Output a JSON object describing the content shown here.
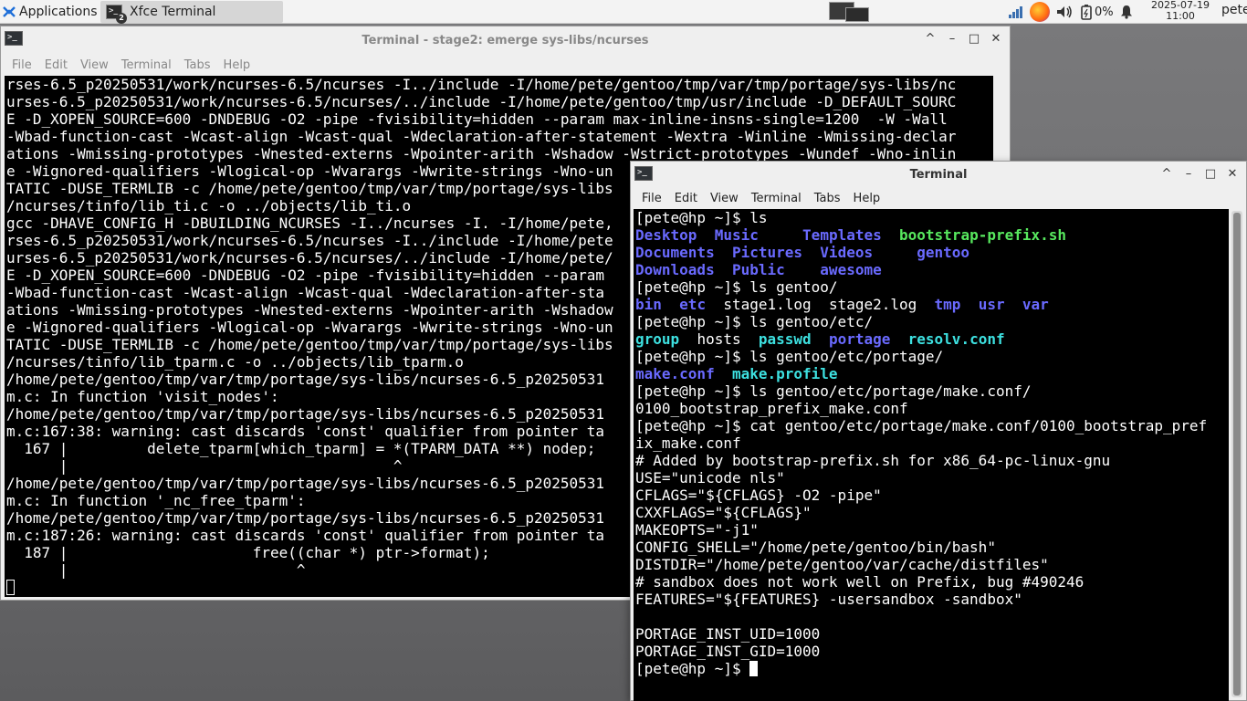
{
  "panel": {
    "apps_label": "Applications",
    "task_label": "Xfce Terminal",
    "task_badge": "2",
    "battery": "0%",
    "date": "2025-07-19",
    "time": "11:00",
    "user": "pete"
  },
  "win1": {
    "title": "Terminal - stage2: emerge sys-libs/ncurses",
    "menu": [
      "File",
      "Edit",
      "View",
      "Terminal",
      "Tabs",
      "Help"
    ],
    "lines": [
      "rses-6.5_p20250531/work/ncurses-6.5/ncurses -I../include -I/home/pete/gentoo/tmp/var/tmp/portage/sys-libs/nc",
      "urses-6.5_p20250531/work/ncurses-6.5/ncurses/../include -I/home/pete/gentoo/tmp/usr/include -D_DEFAULT_SOURC",
      "E -D_XOPEN_SOURCE=600 -DNDEBUG -O2 -pipe -fvisibility=hidden --param max-inline-insns-single=1200  -W -Wall",
      "-Wbad-function-cast -Wcast-align -Wcast-qual -Wdeclaration-after-statement -Wextra -Winline -Wmissing-declar",
      "ations -Wmissing-prototypes -Wnested-externs -Wpointer-arith -Wshadow -Wstrict-prototypes -Wundef -Wno-inlin",
      "e -Wignored-qualifiers -Wlogical-op -Wvarargs -Wwrite-strings -Wno-un",
      "TATIC -DUSE_TERMLIB -c /home/pete/gentoo/tmp/var/tmp/portage/sys-libs",
      "/ncurses/tinfo/lib_ti.c -o ../objects/lib_ti.o",
      "gcc -DHAVE_CONFIG_H -DBUILDING_NCURSES -I../ncurses -I. -I/home/pete,",
      "rses-6.5_p20250531/work/ncurses-6.5/ncurses -I../include -I/home/pete",
      "urses-6.5_p20250531/work/ncurses-6.5/ncurses/../include -I/home/pete/",
      "E -D_XOPEN_SOURCE=600 -DNDEBUG -O2 -pipe -fvisibility=hidden --param",
      "-Wbad-function-cast -Wcast-align -Wcast-qual -Wdeclaration-after-sta",
      "ations -Wmissing-prototypes -Wnested-externs -Wpointer-arith -Wshadow",
      "e -Wignored-qualifiers -Wlogical-op -Wvarargs -Wwrite-strings -Wno-un",
      "TATIC -DUSE_TERMLIB -c /home/pete/gentoo/tmp/var/tmp/portage/sys-libs",
      "/ncurses/tinfo/lib_tparm.c -o ../objects/lib_tparm.o",
      "/home/pete/gentoo/tmp/var/tmp/portage/sys-libs/ncurses-6.5_p20250531",
      "m.c: In function 'visit_nodes':",
      "/home/pete/gentoo/tmp/var/tmp/portage/sys-libs/ncurses-6.5_p20250531",
      "m.c:167:38: warning: cast discards 'const' qualifier from pointer ta",
      "  167 |         delete_tparm[which_tparm] = *(TPARM_DATA **) nodep;",
      "      |                                     ^",
      "/home/pete/gentoo/tmp/var/tmp/portage/sys-libs/ncurses-6.5_p20250531",
      "m.c: In function '_nc_free_tparm':",
      "/home/pete/gentoo/tmp/var/tmp/portage/sys-libs/ncurses-6.5_p20250531",
      "m.c:187:26: warning: cast discards 'const' qualifier from pointer ta",
      "  187 |                     free((char *) ptr->format);",
      "      |                          ^"
    ]
  },
  "win2": {
    "title": "Terminal",
    "menu": [
      "File",
      "Edit",
      "View",
      "Terminal",
      "Tabs",
      "Help"
    ],
    "lines": [
      [
        {
          "t": "[pete@hp ~]$ ls"
        }
      ],
      [
        {
          "t": "Desktop",
          "c": "blue"
        },
        {
          "t": "  "
        },
        {
          "t": "Music",
          "c": "blue"
        },
        {
          "t": "     "
        },
        {
          "t": "Templates",
          "c": "blue"
        },
        {
          "t": "  "
        },
        {
          "t": "bootstrap-prefix.sh",
          "c": "green"
        }
      ],
      [
        {
          "t": "Documents",
          "c": "blue"
        },
        {
          "t": "  "
        },
        {
          "t": "Pictures",
          "c": "blue"
        },
        {
          "t": "  "
        },
        {
          "t": "Videos",
          "c": "blue"
        },
        {
          "t": "     "
        },
        {
          "t": "gentoo",
          "c": "blue"
        }
      ],
      [
        {
          "t": "Downloads",
          "c": "blue"
        },
        {
          "t": "  "
        },
        {
          "t": "Public",
          "c": "blue"
        },
        {
          "t": "    "
        },
        {
          "t": "awesome",
          "c": "blue"
        }
      ],
      [
        {
          "t": "[pete@hp ~]$ ls gentoo/"
        }
      ],
      [
        {
          "t": "bin",
          "c": "blue"
        },
        {
          "t": "  "
        },
        {
          "t": "etc",
          "c": "blue"
        },
        {
          "t": "  stage1.log  stage2.log  "
        },
        {
          "t": "tmp",
          "c": "blue"
        },
        {
          "t": "  "
        },
        {
          "t": "usr",
          "c": "blue"
        },
        {
          "t": "  "
        },
        {
          "t": "var",
          "c": "blue"
        }
      ],
      [
        {
          "t": "[pete@hp ~]$ ls gentoo/etc/"
        }
      ],
      [
        {
          "t": "group",
          "c": "cyan"
        },
        {
          "t": "  hosts  "
        },
        {
          "t": "passwd",
          "c": "cyan"
        },
        {
          "t": "  "
        },
        {
          "t": "portage",
          "c": "blue"
        },
        {
          "t": "  "
        },
        {
          "t": "resolv.conf",
          "c": "cyan"
        }
      ],
      [
        {
          "t": "[pete@hp ~]$ ls gentoo/etc/portage/"
        }
      ],
      [
        {
          "t": "make.conf",
          "c": "blue"
        },
        {
          "t": "  "
        },
        {
          "t": "make.profile",
          "c": "cyan"
        }
      ],
      [
        {
          "t": "[pete@hp ~]$ ls gentoo/etc/portage/make.conf/"
        }
      ],
      [
        {
          "t": "0100_bootstrap_prefix_make.conf"
        }
      ],
      [
        {
          "t": "[pete@hp ~]$ cat gentoo/etc/portage/make.conf/0100_bootstrap_pref"
        }
      ],
      [
        {
          "t": "ix_make.conf"
        }
      ],
      [
        {
          "t": "# Added by bootstrap-prefix.sh for x86_64-pc-linux-gnu"
        }
      ],
      [
        {
          "t": "USE=\"unicode nls\""
        }
      ],
      [
        {
          "t": "CFLAGS=\"${CFLAGS} -O2 -pipe\""
        }
      ],
      [
        {
          "t": "CXXFLAGS=\"${CFLAGS}\""
        }
      ],
      [
        {
          "t": "MAKEOPTS=\"-j1\""
        }
      ],
      [
        {
          "t": "CONFIG_SHELL=\"/home/pete/gentoo/bin/bash\""
        }
      ],
      [
        {
          "t": "DISTDIR=\"/home/pete/gentoo/var/cache/distfiles\""
        }
      ],
      [
        {
          "t": "# sandbox does not work well on Prefix, bug #490246"
        }
      ],
      [
        {
          "t": "FEATURES=\"${FEATURES} -usersandbox -sandbox\""
        }
      ],
      [
        {
          "t": ""
        }
      ],
      [
        {
          "t": "PORTAGE_INST_UID=1000"
        }
      ],
      [
        {
          "t": "PORTAGE_INST_GID=1000"
        }
      ],
      [
        {
          "t": "[pete@hp ~]$ "
        }
      ]
    ]
  }
}
